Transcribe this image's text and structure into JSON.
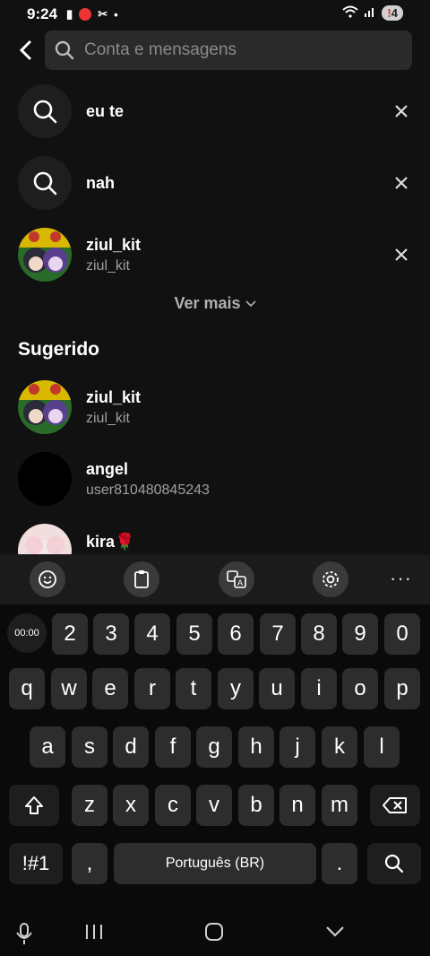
{
  "status": {
    "time": "9:24",
    "battery": "4",
    "battery_alert": "!"
  },
  "search": {
    "placeholder": "Conta e mensagens"
  },
  "recent": [
    {
      "type": "query",
      "text": "eu te"
    },
    {
      "type": "query",
      "text": "nah"
    },
    {
      "type": "user",
      "name": "ziul_kit",
      "handle": "ziul_kit"
    }
  ],
  "ver_mais": "Ver mais",
  "suggested": {
    "title": "Sugerido",
    "users": [
      {
        "name": "ziul_kit",
        "handle": "ziul_kit"
      },
      {
        "name": "angel",
        "handle": "user810480845243"
      },
      {
        "name": "kira🌹",
        "handle": ""
      }
    ]
  },
  "keyboard": {
    "timer": "00:00",
    "row_numbers": [
      "2",
      "3",
      "4",
      "5",
      "6",
      "7",
      "8",
      "9",
      "0"
    ],
    "row1": [
      "q",
      "w",
      "e",
      "r",
      "t",
      "y",
      "u",
      "i",
      "o",
      "p"
    ],
    "row2": [
      "a",
      "s",
      "d",
      "f",
      "g",
      "h",
      "j",
      "k",
      "l"
    ],
    "row3": [
      "z",
      "x",
      "c",
      "v",
      "b",
      "n",
      "m"
    ],
    "symbols": "!#1",
    "comma": ",",
    "space": "Português (BR)",
    "period": "."
  },
  "toolbar": {
    "more": "···"
  },
  "icons": [
    "back-icon",
    "search-icon",
    "close-icon",
    "chevron-down-icon",
    "emoji-icon",
    "clipboard-icon",
    "translate-icon",
    "settings-icon",
    "shift-icon",
    "backspace-icon",
    "mic-icon",
    "recents-icon",
    "home-icon",
    "nav-down-icon"
  ]
}
